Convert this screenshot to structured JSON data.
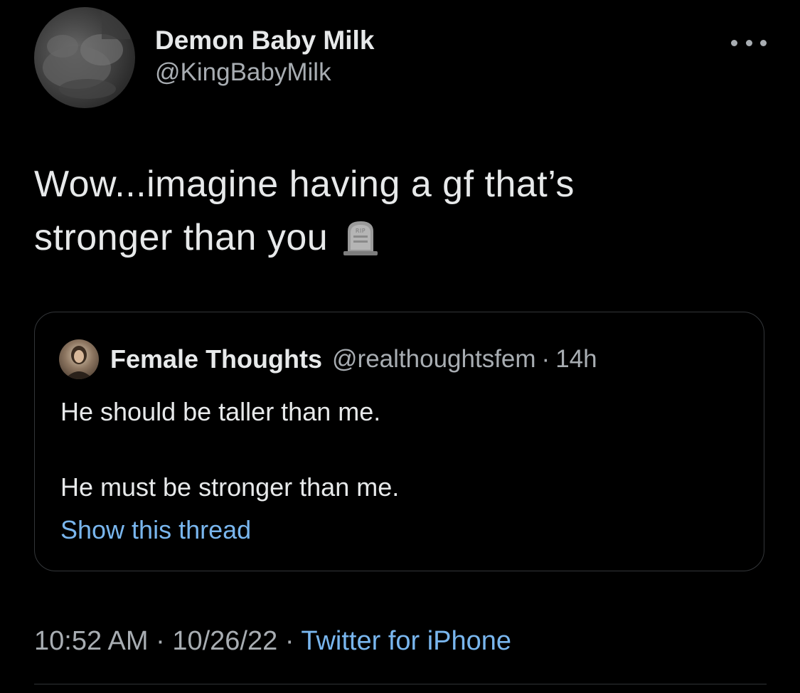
{
  "tweet": {
    "author": {
      "display_name": "Demon Baby Milk",
      "handle": "@KingBabyMilk"
    },
    "text_line1": "Wow...imagine having a gf that’s",
    "text_line2": "stronger than you",
    "emoji": "headstone-emoji",
    "quoted_tweet": {
      "display_name": "Female Thoughts",
      "handle": "@realthoughtsfem",
      "separator": "·",
      "age": "14h",
      "line1": "He should be taller than me.",
      "line2": "He must be stronger than me.",
      "show_thread_label": "Show this thread"
    },
    "meta": {
      "time": "10:52 AM",
      "separator1": "·",
      "date": "10/26/22",
      "separator2": "·",
      "source": "Twitter for iPhone"
    }
  },
  "colors": {
    "background": "#000000",
    "primary_text": "#e7e9ea",
    "secondary_text": "#a8adb2",
    "link": "#79b6ee",
    "border": "#333639"
  }
}
